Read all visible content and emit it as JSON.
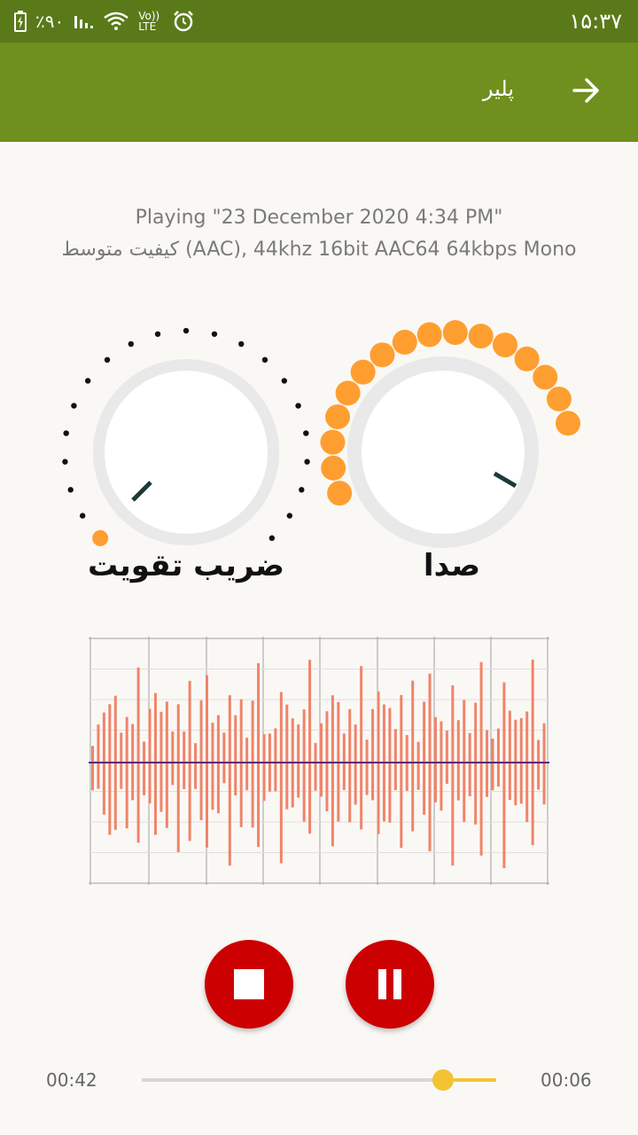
{
  "status": {
    "battery": "٪۹۰",
    "network_label": "Vo)) LTE",
    "time": "۱۵:۳۷"
  },
  "app_bar": {
    "title": "پلیر"
  },
  "info": {
    "playing": "Playing \"23 December 2020 4:34 PM\"",
    "quality": "کیفیت متوسط (AAC), 44khz 16bit AAC64 64kbps Mono"
  },
  "knobs": {
    "gain_label": "ضریب تقویت",
    "volume_label": "صدا"
  },
  "player": {
    "elapsed": "00:42",
    "remaining": "00:06",
    "progress": 0.85
  },
  "colors": {
    "status_bar": "#5a7a1a",
    "app_bar": "#6f8f1e",
    "accent_orange": "#ff9e30",
    "waveform": "#f08469",
    "control_red": "#cc0000",
    "seek": "#f4c331"
  }
}
